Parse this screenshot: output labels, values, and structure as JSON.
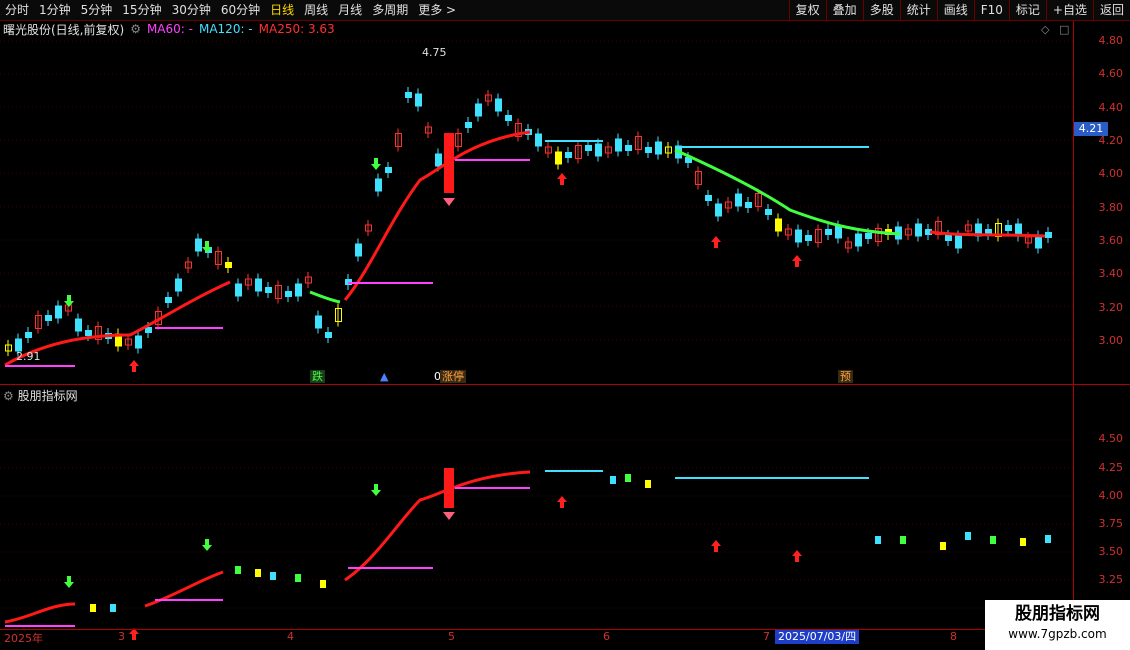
{
  "toolbar": {
    "periods": [
      "分时",
      "1分钟",
      "5分钟",
      "15分钟",
      "30分钟",
      "60分钟",
      "日线",
      "周线",
      "月线",
      "多周期",
      "更多 >"
    ],
    "active_period": "日线",
    "buttons": [
      "复权",
      "叠加",
      "多股",
      "统计",
      "画线",
      "F10",
      "标记",
      "+自选",
      "返回"
    ]
  },
  "main_pane": {
    "stock_name": "曙光股份(日线,前复权)",
    "ma60_label": "MA60: -",
    "ma120_label": "MA120: -",
    "ma250_label": "MA250: 3.63",
    "ma60_color": "#ff40ff",
    "ma120_color": "#40e0ff",
    "ma250_color": "#ff3030",
    "y_ticks": [
      "4.80",
      "4.60",
      "4.40",
      "4.20",
      "4.00",
      "3.80",
      "3.60",
      "3.40",
      "3.20",
      "3.00"
    ],
    "current_price": "4.21",
    "high_marker": "4.75",
    "low_marker": "2.91",
    "signals": {
      "drop": "跌",
      "limit_up": "涨停",
      "pre": "预",
      "zero": "0"
    }
  },
  "sub_pane": {
    "title": "股朋指标网",
    "y_ticks": [
      "4.50",
      "4.25",
      "4.00",
      "3.75",
      "3.50",
      "3.25"
    ]
  },
  "xaxis": {
    "labels": [
      "2025年",
      "3",
      "4",
      "5",
      "6",
      "7",
      "8"
    ],
    "selected_date": "2025/07/03/四"
  },
  "watermark": {
    "title": "股朋指标网",
    "url": "www.7gpzb.com"
  }
}
